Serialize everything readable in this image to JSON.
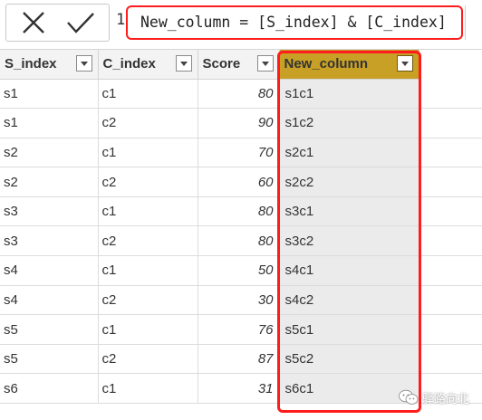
{
  "formula_bar": {
    "line_number": "1",
    "expression": "New_column = [S_index] & [C_index]",
    "cancel_icon": "close-icon",
    "commit_icon": "checkmark-icon"
  },
  "table": {
    "columns": [
      {
        "label": "S_index",
        "type": "text"
      },
      {
        "label": "C_index",
        "type": "text"
      },
      {
        "label": "Score",
        "type": "number"
      },
      {
        "label": "New_column",
        "type": "text",
        "highlighted": true
      }
    ],
    "rows": [
      [
        "s1",
        "c1",
        "80",
        "s1c1"
      ],
      [
        "s1",
        "c2",
        "90",
        "s1c2"
      ],
      [
        "s2",
        "c1",
        "70",
        "s2c1"
      ],
      [
        "s2",
        "c2",
        "60",
        "s2c2"
      ],
      [
        "s3",
        "c1",
        "80",
        "s3c1"
      ],
      [
        "s3",
        "c2",
        "80",
        "s3c2"
      ],
      [
        "s4",
        "c1",
        "50",
        "s4c1"
      ],
      [
        "s4",
        "c2",
        "30",
        "s4c2"
      ],
      [
        "s5",
        "c1",
        "76",
        "s5c1"
      ],
      [
        "s5",
        "c2",
        "87",
        "s5c2"
      ],
      [
        "s6",
        "c1",
        "31",
        "s6c1"
      ]
    ]
  },
  "colors": {
    "annotation_red": "#ff1c1c",
    "selected_header": "#c8a025",
    "selected_column_bg": "#ebebeb"
  },
  "watermark": {
    "text": "驿路向北",
    "icon": "wechat-icon"
  }
}
